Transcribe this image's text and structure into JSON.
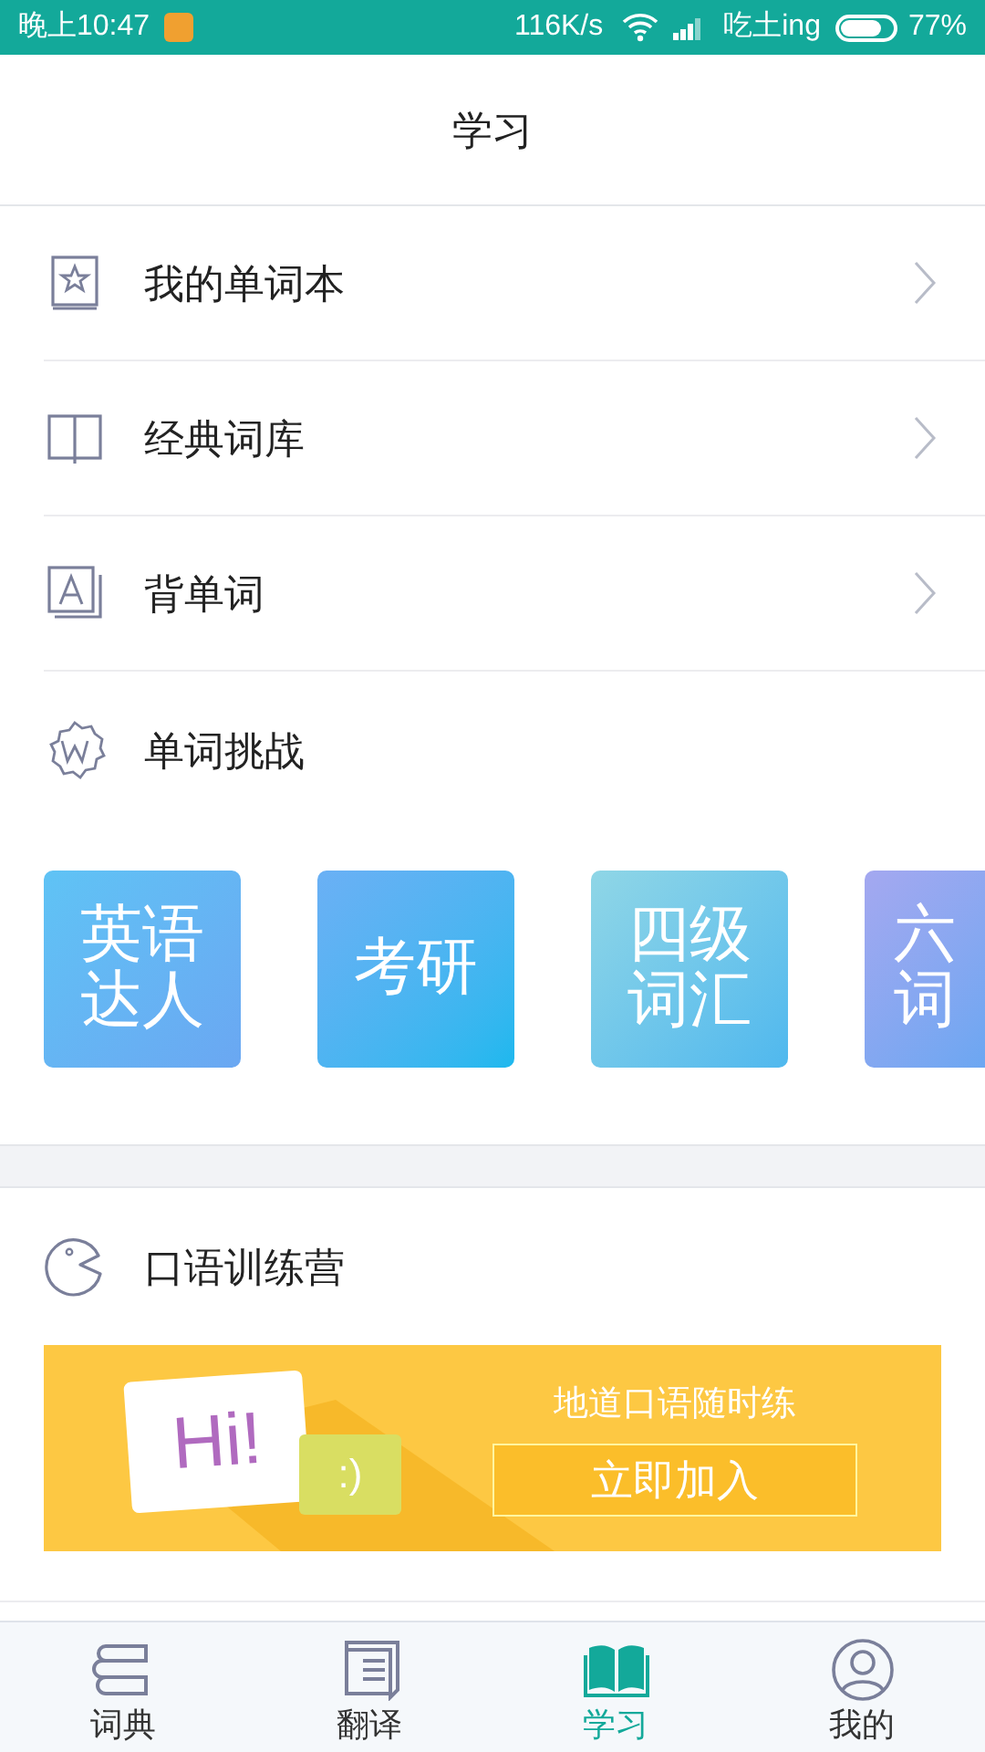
{
  "status_bar": {
    "time": "晚上10:47",
    "speed": "116K/s",
    "carrier": "吃土ing",
    "battery": "77%"
  },
  "header": {
    "title": "学习"
  },
  "menu": [
    {
      "label": "我的单词本"
    },
    {
      "label": "经典词库"
    },
    {
      "label": "背单词"
    }
  ],
  "challenge": {
    "title": "单词挑战",
    "tiles": [
      {
        "lines": [
          "英语",
          "达人"
        ]
      },
      {
        "lines": [
          "考研"
        ]
      },
      {
        "lines": [
          "四级",
          "词汇"
        ]
      },
      {
        "lines": [
          "六",
          "词"
        ]
      }
    ]
  },
  "speaking": {
    "title": "口语训练营",
    "banner": {
      "bubble_text": "Hi!",
      "small_bubble_text": ":)",
      "slogan": "地道口语随时练",
      "button": "立即加入"
    }
  },
  "tabs": [
    {
      "label": "词典",
      "selected": false
    },
    {
      "label": "翻译",
      "selected": false
    },
    {
      "label": "学习",
      "selected": true
    },
    {
      "label": "我的",
      "selected": false
    }
  ]
}
